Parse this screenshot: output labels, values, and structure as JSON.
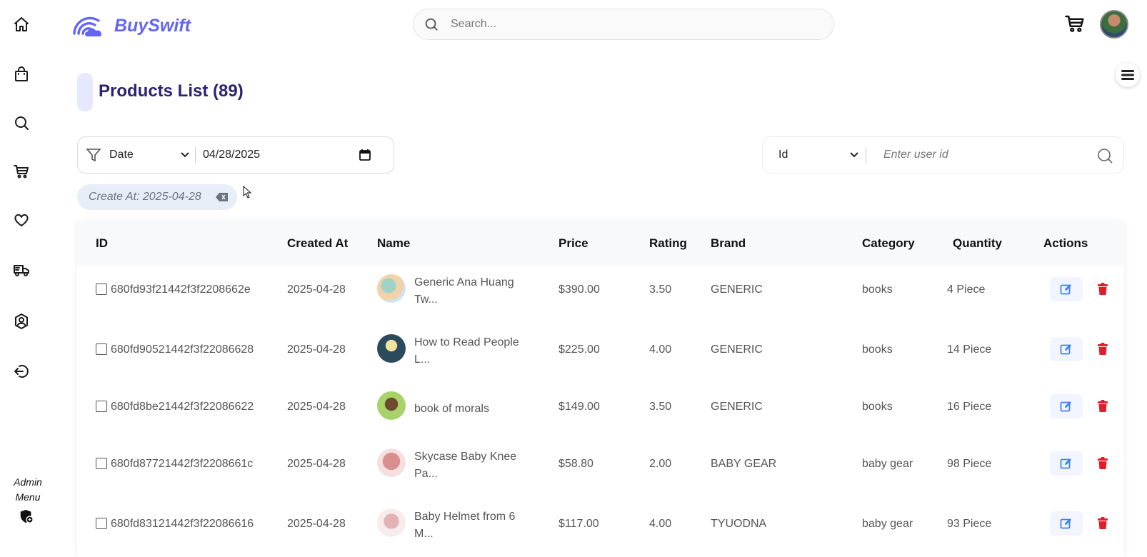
{
  "app": {
    "name": "BuySwift"
  },
  "search": {
    "placeholder": "Search..."
  },
  "sidebar": {
    "admin_label_line1": "Admin",
    "admin_label_line2": "Menu"
  },
  "page": {
    "title": "Products List (89)"
  },
  "filter": {
    "field": "Date",
    "date_value": "04/28/2025",
    "chip": "Create At: 2025-04-28"
  },
  "id_filter": {
    "field": "Id",
    "placeholder": "Enter user id"
  },
  "table": {
    "headers": [
      "ID",
      "Created At",
      "Name",
      "Price",
      "Rating",
      "Brand",
      "Category",
      "Quantity",
      "Actions"
    ],
    "rows": [
      {
        "id": "680fd93f21442f3f2208662e",
        "created": "2025-04-28",
        "name1": "Generic Ana Huang",
        "name2": "Tw...",
        "price": "$390.00",
        "rating": "3.50",
        "brand": "GENERIC",
        "category": "books",
        "qty": "4 Piece"
      },
      {
        "id": "680fd90521442f3f22086628",
        "created": "2025-04-28",
        "name1": "How to Read People",
        "name2": "L...",
        "price": "$225.00",
        "rating": "4.00",
        "brand": "GENERIC",
        "category": "books",
        "qty": "14 Piece"
      },
      {
        "id": "680fd8be21442f3f22086622",
        "created": "2025-04-28",
        "name1": "book of morals",
        "name2": "",
        "price": "$149.00",
        "rating": "3.50",
        "brand": "GENERIC",
        "category": "books",
        "qty": "16 Piece"
      },
      {
        "id": "680fd87721442f3f2208661c",
        "created": "2025-04-28",
        "name1": "Skycase Baby Knee",
        "name2": "Pa...",
        "price": "$58.80",
        "rating": "2.00",
        "brand": "BABY GEAR",
        "category": "baby gear",
        "qty": "98 Piece"
      },
      {
        "id": "680fd83121442f3f22086616",
        "created": "2025-04-28",
        "name1": "Baby Helmet from 6",
        "name2": "M...",
        "price": "$117.00",
        "rating": "4.00",
        "brand": "TYUODNA",
        "category": "baby gear",
        "qty": "93 Piece"
      }
    ]
  },
  "colors": {
    "brand": "#6366f1",
    "title": "#2b2370",
    "edit": "#3b82f6",
    "delete": "#e11d2a"
  }
}
